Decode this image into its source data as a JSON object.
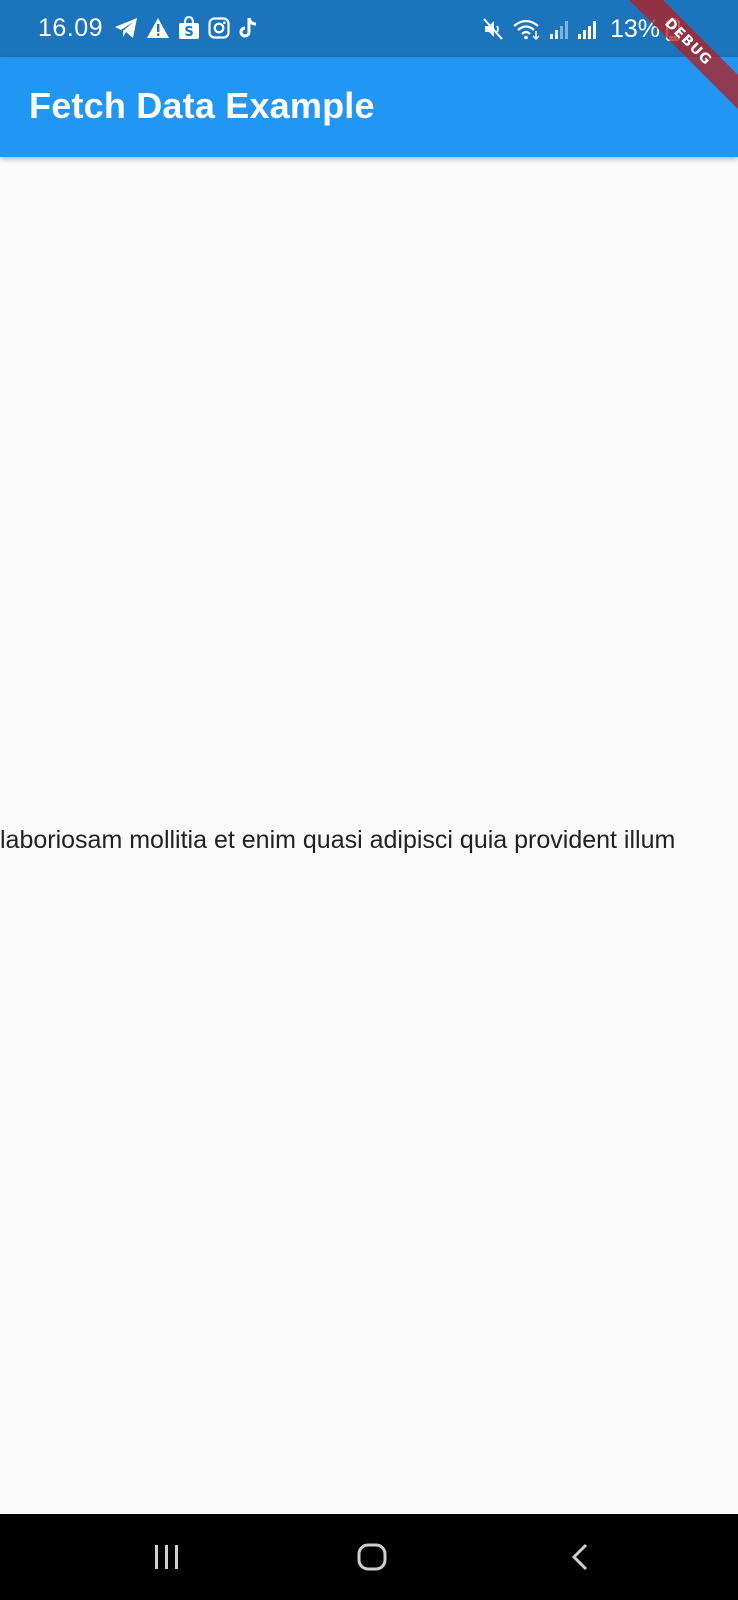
{
  "status_bar": {
    "time": "16.09",
    "battery_text": "13%",
    "left_icons": [
      "telegram-icon",
      "warning-icon",
      "shopee-icon",
      "instagram-icon",
      "tiktok-icon"
    ],
    "right_icons": [
      "mute-icon",
      "wifi-icon",
      "signal-icon",
      "signal-icon",
      "battery-icon"
    ]
  },
  "app_bar": {
    "title": "Fetch Data Example",
    "color": "#2196f3"
  },
  "debug_banner": {
    "label": "DEBUG"
  },
  "content": {
    "text": "laboriosam mollitia et enim quasi adipisci quia provident illum"
  },
  "nav_bar": {
    "buttons": [
      "recent-apps-icon",
      "home-icon",
      "back-icon"
    ]
  }
}
